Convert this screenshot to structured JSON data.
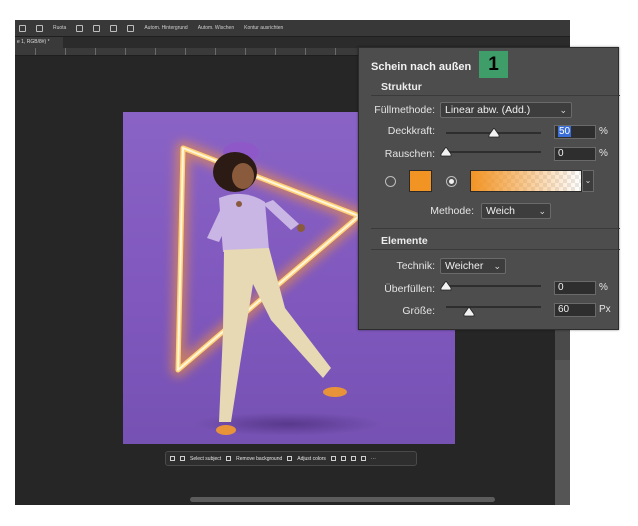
{
  "app": {
    "toolbar_items": [
      "Ruota",
      "Autom. Hintergrund",
      "Autom. Wischen",
      "Kontur ausrichten"
    ],
    "doc_tab": "e 1, RGB/8#) *",
    "context_bar": {
      "select_subject": "Select subject",
      "remove_background": "Remove background",
      "adjust_colors": "Adjust colors",
      "more": "···"
    }
  },
  "panel": {
    "title": "Schein nach außen",
    "badge": "1",
    "struktur": {
      "heading": "Struktur",
      "fuellmethode_label": "Füllmethode:",
      "fuellmethode_value": "Linear abw. (Add.)",
      "deckkraft_label": "Deckkraft:",
      "deckkraft_value": "50",
      "deckkraft_unit": "%",
      "deckkraft_fraction": 0.5,
      "rauschen_label": "Rauschen:",
      "rauschen_value": "0",
      "rauschen_unit": "%",
      "rauschen_fraction": 0.0,
      "color_swatch": "#f29424",
      "methode_label": "Methode:",
      "methode_value": "Weich"
    },
    "elemente": {
      "heading": "Elemente",
      "technik_label": "Technik:",
      "technik_value": "Weicher",
      "ueberfuellen_label": "Überfüllen:",
      "ueberfuellen_value": "0",
      "ueberfuellen_unit": "%",
      "ueberfuellen_fraction": 0.0,
      "groesse_label": "Größe:",
      "groesse_value": "60",
      "groesse_unit": "Px",
      "groesse_fraction": 0.24
    }
  },
  "colors": {
    "canvas": "#8a63c6",
    "glow": "#ffbf55",
    "accent_badge": "#3e9d69"
  }
}
